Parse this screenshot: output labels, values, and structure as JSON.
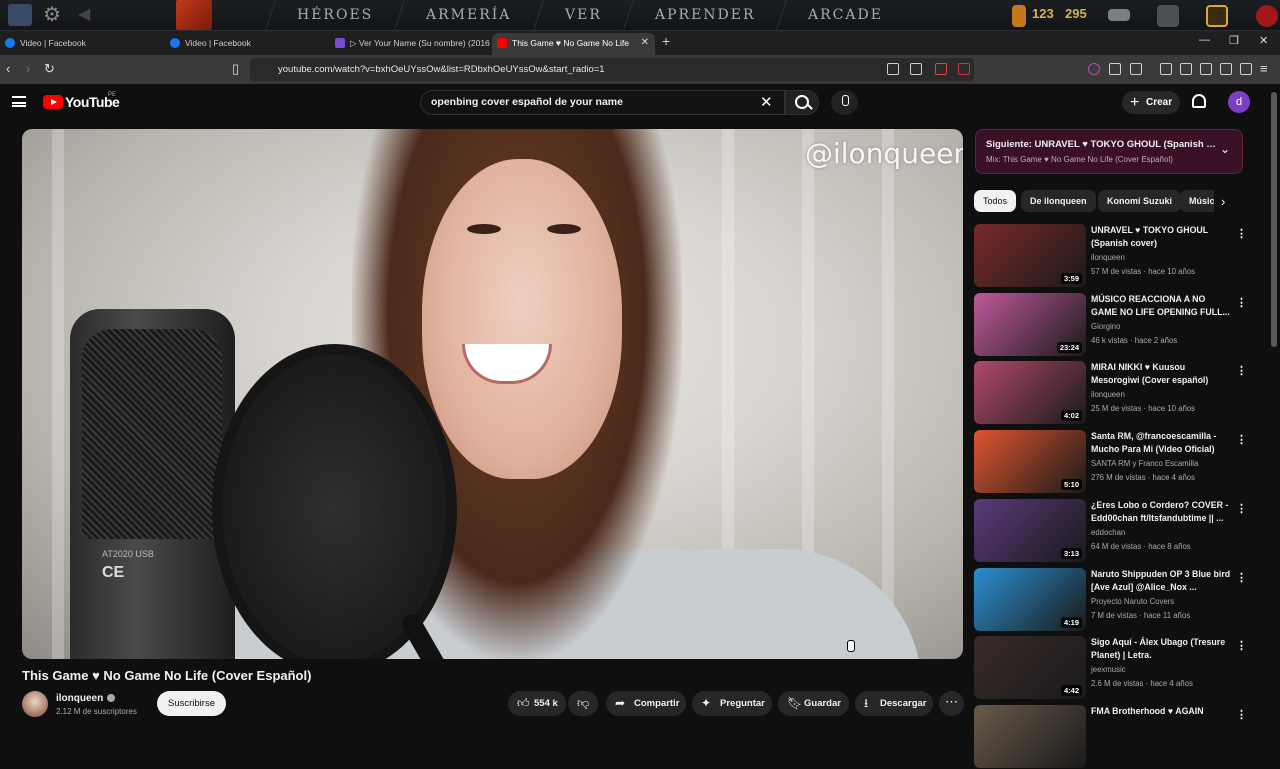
{
  "game": {
    "nav": [
      "HÉROES",
      "ARMERÍA",
      "VER",
      "APRENDER",
      "ARCADE"
    ],
    "currency_a": "123",
    "currency_b": "295"
  },
  "tabs": [
    {
      "title": "Video | Facebook",
      "fav_color": "#1877f2"
    },
    {
      "title": "Video | Facebook",
      "fav_color": "#1877f2"
    },
    {
      "title": "▷ Ver Your Name (Su nombre) (2016",
      "fav_color": "#7a4bd1"
    },
    {
      "title": "This Game ♥ No Game No Life",
      "fav_color": "#ff0000"
    }
  ],
  "browser": {
    "url": "youtube.com/watch?v=bxhOeUYssOw&list=RDbxhOeUYssOw&start_radio=1",
    "new_tab": "+"
  },
  "yt": {
    "logo_text": "YouTube",
    "region": "PE",
    "search_query": "openbing cover español de your name",
    "create_label": "Crear",
    "avatar_letter": "d"
  },
  "video": {
    "watermark": "@ilonqueen",
    "mic_brand": "AT2020 USB",
    "title": "This Game ♥ No Game No Life (Cover Español)",
    "channel": "ilonqueen",
    "subscribers": "2.12 M de suscriptores",
    "subscribe_label": "Suscribirse",
    "likes": "554 k",
    "share_label": "Compartir",
    "ask_label": "Preguntar",
    "save_label": "Guardar",
    "download_label": "Descargar"
  },
  "mix": {
    "next": "Siguiente: UNRAVEL ♥ TOKYO GHOUL (Spanish cover)",
    "subtitle": "Mix: This Game ♥ No Game No Life (Cover Español)"
  },
  "chips": [
    "Todos",
    "De ilonqueen",
    "Konomi Suzuki",
    "Música"
  ],
  "recommendations": [
    {
      "title": "UNRAVEL ♥ TOKYO GHOUL (Spanish cover)",
      "channel": "ilonqueen",
      "meta": "57 M de vistas · hace 10 años",
      "duration": "3:59",
      "thumb": "#7a2a2a"
    },
    {
      "title": "MÚSICO REACCIONA A NO GAME NO LIFE OPENING FULL...",
      "channel": "Giorgino",
      "meta": "46 k vistas · hace 2 años",
      "duration": "23:24",
      "thumb": "#c05a9a"
    },
    {
      "title": "MIRAI NIKKI ♥ Kuusou Mesorogiwi (Cover español)",
      "channel": "ilonqueen",
      "meta": "25 M de vistas · hace 10 años",
      "duration": "4:02",
      "thumb": "#b04a6a"
    },
    {
      "title": "Santa RM, @francoescamilla - Mucho Para Mi (Video Oficial)",
      "channel": "SANTA RM y Franco Escamilla",
      "meta": "276 M de vistas · hace 4 años",
      "duration": "5:10",
      "thumb": "#e0552f"
    },
    {
      "title": "¿Eres Lobo o Cordero? COVER - Edd00chan ft/Itsfandubtime || ...",
      "channel": "eddochan",
      "meta": "64 M de vistas · hace 8 años",
      "duration": "3:13",
      "thumb": "#5a3a7a"
    },
    {
      "title": "Naruto Shippuden OP 3 Blue bird [Ave Azul] @Alice_Nox ...",
      "channel": "Proyecto Naruto Covers",
      "meta": "7 M de vistas · hace 11 años",
      "duration": "4:19",
      "thumb": "#2a8fd0"
    },
    {
      "title": "Sigo Aquí - Álex Ubago (Tresure Planet) | Letra.",
      "channel": "jeexmusic",
      "meta": "2.6 M de vistas · hace 4 años",
      "duration": "4:42",
      "thumb": "#3a2a2a"
    },
    {
      "title": "FMA Brotherhood ♥ AGAIN",
      "channel": "",
      "meta": "",
      "duration": "",
      "thumb": "#6a5a4a"
    }
  ]
}
